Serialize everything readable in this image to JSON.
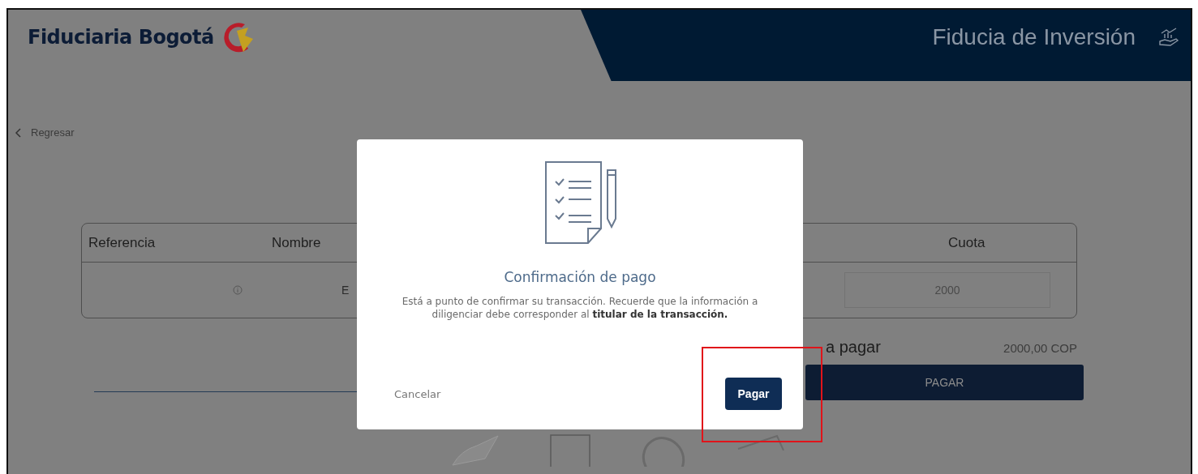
{
  "header": {
    "brand": "Fiduciaria Bogotá",
    "section_title": "Fiducia de Inversión"
  },
  "back_link": "Regresar",
  "table": {
    "columns": [
      "Referencia",
      "Nombre",
      "Cuota"
    ],
    "rows": [
      {
        "column_2": "E",
        "cuota": "2000"
      }
    ]
  },
  "total": {
    "label": "a pagar",
    "amount": "2000,00 COP"
  },
  "pay_button": "PAGAR",
  "modal": {
    "title": "Confirmación de pago",
    "message": "Está a punto de confirmar su transacción. Recuerde que la información a diligenciar debe corresponder al **titular de la transacción.**",
    "cancel": "Cancelar",
    "confirm": "Pagar"
  }
}
